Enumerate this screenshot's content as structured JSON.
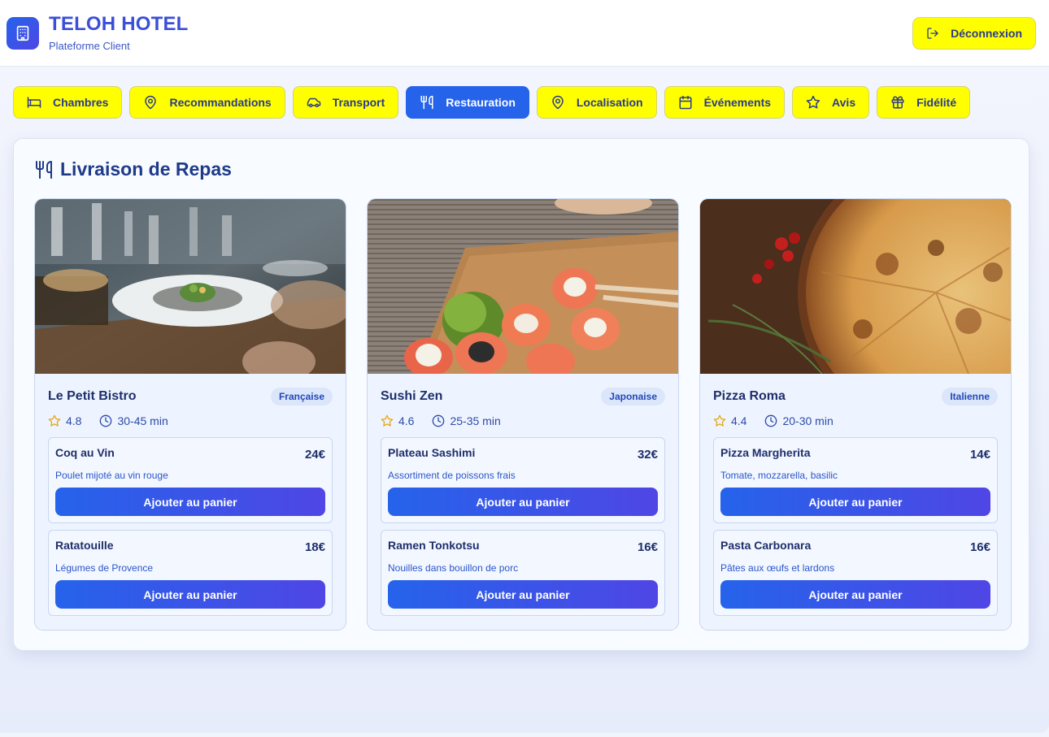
{
  "header": {
    "title": "TELOH HOTEL",
    "subtitle": "Plateforme Client",
    "logout_label": "Déconnexion"
  },
  "tabs": [
    {
      "label": "Chambres",
      "icon": "bed-icon"
    },
    {
      "label": "Recommandations",
      "icon": "map-pin-icon"
    },
    {
      "label": "Transport",
      "icon": "car-icon"
    },
    {
      "label": "Restauration",
      "icon": "utensils-icon",
      "active": true
    },
    {
      "label": "Localisation",
      "icon": "map-pin-icon"
    },
    {
      "label": "Événements",
      "icon": "calendar-icon"
    },
    {
      "label": "Avis",
      "icon": "star-icon"
    },
    {
      "label": "Fidélité",
      "icon": "gift-icon"
    }
  ],
  "section": {
    "title": "Livraison de Repas"
  },
  "restaurants": [
    {
      "name": "Le Petit Bistro",
      "cuisine": "Française",
      "rating": "4.8",
      "delivery_time": "30-45 min",
      "image": "restaurant-dining-photo",
      "dishes": [
        {
          "name": "Coq au Vin",
          "price": "24€",
          "description": "Poulet mijoté au vin rouge",
          "button": "Ajouter au panier"
        },
        {
          "name": "Ratatouille",
          "price": "18€",
          "description": "Légumes de Provence",
          "button": "Ajouter au panier"
        }
      ]
    },
    {
      "name": "Sushi Zen",
      "cuisine": "Japonaise",
      "rating": "4.6",
      "delivery_time": "25-35 min",
      "image": "sushi-photo",
      "dishes": [
        {
          "name": "Plateau Sashimi",
          "price": "32€",
          "description": "Assortiment de poissons frais",
          "button": "Ajouter au panier"
        },
        {
          "name": "Ramen Tonkotsu",
          "price": "16€",
          "description": "Nouilles dans bouillon de porc",
          "button": "Ajouter au panier"
        }
      ]
    },
    {
      "name": "Pizza Roma",
      "cuisine": "Italienne",
      "rating": "4.4",
      "delivery_time": "20-30 min",
      "image": "pizza-photo",
      "dishes": [
        {
          "name": "Pizza Margherita",
          "price": "14€",
          "description": "Tomate, mozzarella, basilic",
          "button": "Ajouter au panier"
        },
        {
          "name": "Pasta Carbonara",
          "price": "16€",
          "description": "Pâtes aux œufs et lardons",
          "button": "Ajouter au panier"
        }
      ]
    }
  ],
  "colors": {
    "accent": "#2563eb",
    "accent_end": "#4f46e5",
    "tab_bg": "#ffff00",
    "rating_star": "#e5a91a"
  }
}
